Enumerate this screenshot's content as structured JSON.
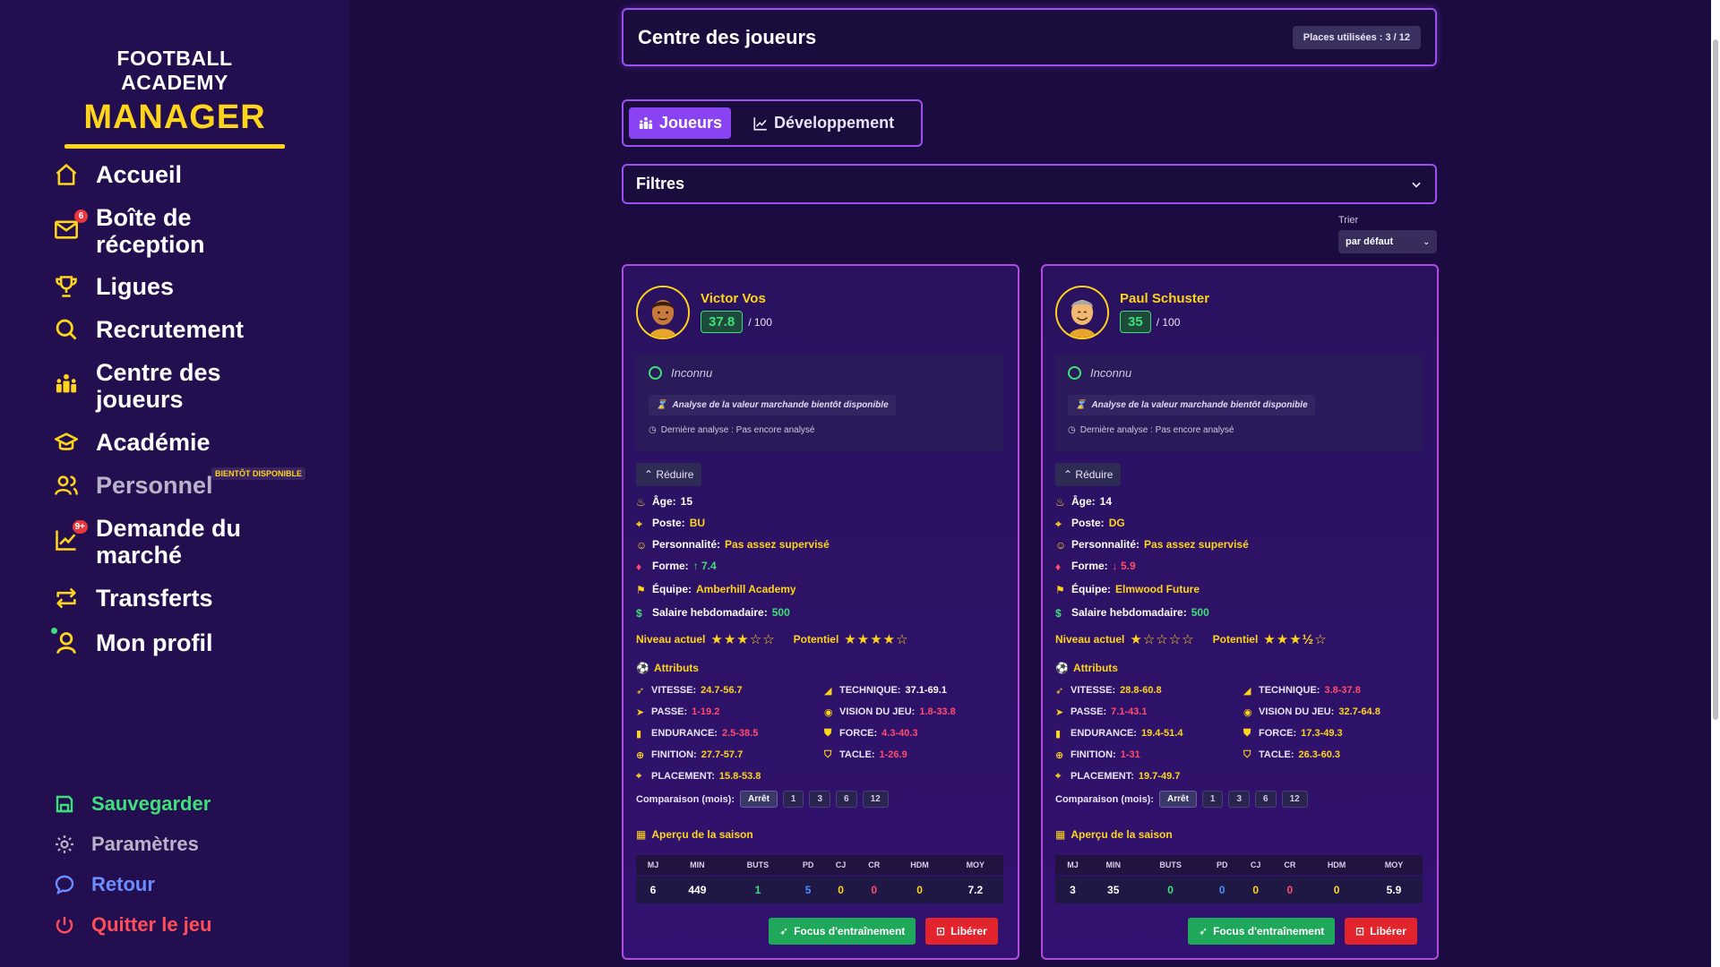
{
  "sidebar": {
    "logo_line1": "FOOTBALL ACADEMY",
    "logo_line2": "MANAGER",
    "nav": [
      {
        "label": "Accueil",
        "icon": "home-icon"
      },
      {
        "label": "Boîte de réception",
        "icon": "mail-icon",
        "badge": "6"
      },
      {
        "label": "Ligues",
        "icon": "trophy-icon"
      },
      {
        "label": "Recrutement",
        "icon": "search-icon"
      },
      {
        "label": "Centre des joueurs",
        "icon": "players-icon"
      },
      {
        "label": "Académie",
        "icon": "graduation-icon"
      },
      {
        "label": "Personnel",
        "icon": "staff-icon",
        "tag": "BIENTÔT DISPONIBLE"
      },
      {
        "label": "Demande du marché",
        "icon": "chart-icon",
        "badge": "9+"
      },
      {
        "label": "Transferts",
        "icon": "transfer-icon"
      },
      {
        "label": "Mon profil",
        "icon": "user-icon"
      }
    ],
    "bottom": {
      "save": "Sauvegarder",
      "settings": "Paramètres",
      "back": "Retour",
      "quit": "Quitter le jeu"
    },
    "colors": {
      "accent": "#ffd51c",
      "save": "#3ee07a",
      "settings": "#b9b3c9",
      "back": "#6b8dff",
      "quit": "#ff4d5a"
    }
  },
  "header": {
    "title": "Centre des joueurs",
    "slots": "Places utilisées : 3 / 12"
  },
  "tabs": [
    {
      "label": "Joueurs",
      "active": true
    },
    {
      "label": "Développement",
      "active": false
    }
  ],
  "filters": {
    "label": "Filtres"
  },
  "sort": {
    "label": "Trier",
    "value": "par défaut"
  },
  "players": [
    {
      "name": "Victor Vos",
      "rating": "37.8",
      "max": "/ 100",
      "value": "Inconnu",
      "analysis": "Analyse de la valeur marchande bientôt disponible",
      "last_analysis": "Dernière analyse : Pas encore analysé",
      "collapse": "Réduire",
      "age_label": "Âge:",
      "age": "15",
      "pos_label": "Poste:",
      "pos": "BU",
      "pers_label": "Personnalité:",
      "pers": "Pas assez supervisé",
      "form_label": "Forme:",
      "form": "↑ 7.4",
      "team_label": "Équipe:",
      "team": "Amberhill Academy",
      "salary_label": "Salaire hebdomadaire:",
      "salary": "500",
      "level_label": "Niveau actuel",
      "level_stars": "★★★☆☆",
      "current_level": 3,
      "potential_label": "Potentiel",
      "potential_stars": "★★★★☆",
      "potential": 4,
      "attr_title": "Attributs",
      "attrs": [
        {
          "name": "VITESSE:",
          "val": "24.7-56.7",
          "c": "yellow"
        },
        {
          "name": "TECHNIQUE:",
          "val": "37.1-69.1",
          "c": "white"
        },
        {
          "name": "PASSE:",
          "val": "1-19.2",
          "c": "red"
        },
        {
          "name": "VISION DU JEU:",
          "val": "1.8-33.8",
          "c": "red"
        },
        {
          "name": "ENDURANCE:",
          "val": "2.5-38.5",
          "c": "red"
        },
        {
          "name": "FORCE:",
          "val": "4.3-40.3",
          "c": "red"
        },
        {
          "name": "FINITION:",
          "val": "27.7-57.7",
          "c": "yellow"
        },
        {
          "name": "TACLE:",
          "val": "1-26.9",
          "c": "red"
        },
        {
          "name": "PLACEMENT:",
          "val": "15.8-53.8",
          "c": "yellow"
        }
      ],
      "compare_label": "Comparaison (mois):",
      "season_title": "Aperçu de la saison",
      "season": {
        "MJ": "6",
        "MIN": "449",
        "BUTS": "1",
        "PD": "5",
        "CJ": "0",
        "CR": "0",
        "HDM": "0",
        "MOY": "7.2"
      },
      "focus": "Focus d'entraînement",
      "release": "Libérer"
    },
    {
      "name": "Paul Schuster",
      "rating": "35",
      "max": "/ 100",
      "value": "Inconnu",
      "analysis": "Analyse de la valeur marchande bientôt disponible",
      "last_analysis": "Dernière analyse : Pas encore analysé",
      "collapse": "Réduire",
      "age_label": "Âge:",
      "age": "14",
      "pos_label": "Poste:",
      "pos": "DG",
      "pers_label": "Personnalité:",
      "pers": "Pas assez supervisé",
      "form_label": "Forme:",
      "form": "↓ 5.9",
      "team_label": "Équipe:",
      "team": "Elmwood Future",
      "salary_label": "Salaire hebdomadaire:",
      "salary": "500",
      "level_label": "Niveau actuel",
      "level_stars": "★☆☆☆☆",
      "current_level": 1,
      "potential_label": "Potentiel",
      "potential_stars": "★★★½☆",
      "potential": 3.5,
      "attr_title": "Attributs",
      "attrs": [
        {
          "name": "VITESSE:",
          "val": "28.8-60.8",
          "c": "yellow"
        },
        {
          "name": "TECHNIQUE:",
          "val": "3.8-37.8",
          "c": "red"
        },
        {
          "name": "PASSE:",
          "val": "7.1-43.1",
          "c": "red"
        },
        {
          "name": "VISION DU JEU:",
          "val": "32.7-64.8",
          "c": "yellow"
        },
        {
          "name": "ENDURANCE:",
          "val": "19.4-51.4",
          "c": "yellow"
        },
        {
          "name": "FORCE:",
          "val": "17.3-49.3",
          "c": "yellow"
        },
        {
          "name": "FINITION:",
          "val": "1-31",
          "c": "red"
        },
        {
          "name": "TACLE:",
          "val": "26.3-60.3",
          "c": "yellow"
        },
        {
          "name": "PLACEMENT:",
          "val": "19.7-49.7",
          "c": "yellow"
        }
      ],
      "compare_label": "Comparaison (mois):",
      "season_title": "Aperçu de la saison",
      "season": {
        "MJ": "3",
        "MIN": "35",
        "BUTS": "0",
        "PD": "0",
        "CJ": "0",
        "CR": "0",
        "HDM": "0",
        "MOY": "5.9"
      },
      "focus": "Focus d'entraînement",
      "release": "Libérer"
    }
  ],
  "compare_options": [
    "Arrêt",
    "1",
    "3",
    "6",
    "12"
  ],
  "season_headers": [
    "MJ",
    "MIN",
    "BUTS",
    "PD",
    "CJ",
    "CR",
    "HDM",
    "MOY"
  ]
}
